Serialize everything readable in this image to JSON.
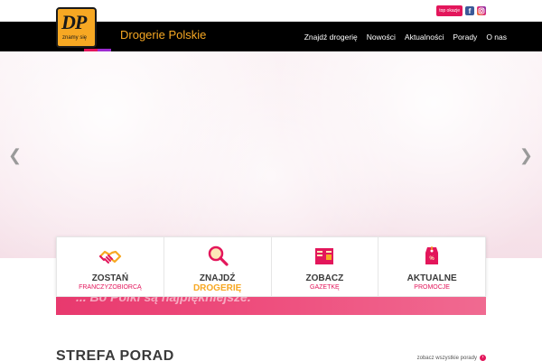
{
  "top": {
    "badge": "top okazje",
    "social": [
      {
        "name": "facebook-icon",
        "glyph": "f"
      },
      {
        "name": "instagram-icon",
        "glyph": ""
      }
    ]
  },
  "brand": {
    "logo_text": "DP",
    "logo_sub": "znamy się",
    "name": "Drogerie Polskie"
  },
  "nav": {
    "items": [
      "Znajdź drogerię",
      "Nowości",
      "Aktualności",
      "Porady",
      "O nas"
    ]
  },
  "slider": {
    "prev": "❮",
    "next": "❯"
  },
  "tiles": [
    {
      "title": "ZOSTAŃ",
      "sub": "FRANCZYZOBIORCĄ"
    },
    {
      "title": "ZNAJDŹ",
      "sub": "DROGERIĘ"
    },
    {
      "title": "ZOBACZ",
      "sub": "GAZETKĘ"
    },
    {
      "title": "AKTUALNE",
      "sub": "PROMOCJE"
    }
  ],
  "banner": {
    "text": "... Bo Polki są najpiękniejsze."
  },
  "section": {
    "title": "STREFA PORAD",
    "see_all": "zobacz wszystkie porady",
    "see_all_arrow": "›"
  },
  "colors": {
    "accent_pink": "#e3165b",
    "accent_orange": "#f7a823",
    "nav_bg": "#000000"
  }
}
